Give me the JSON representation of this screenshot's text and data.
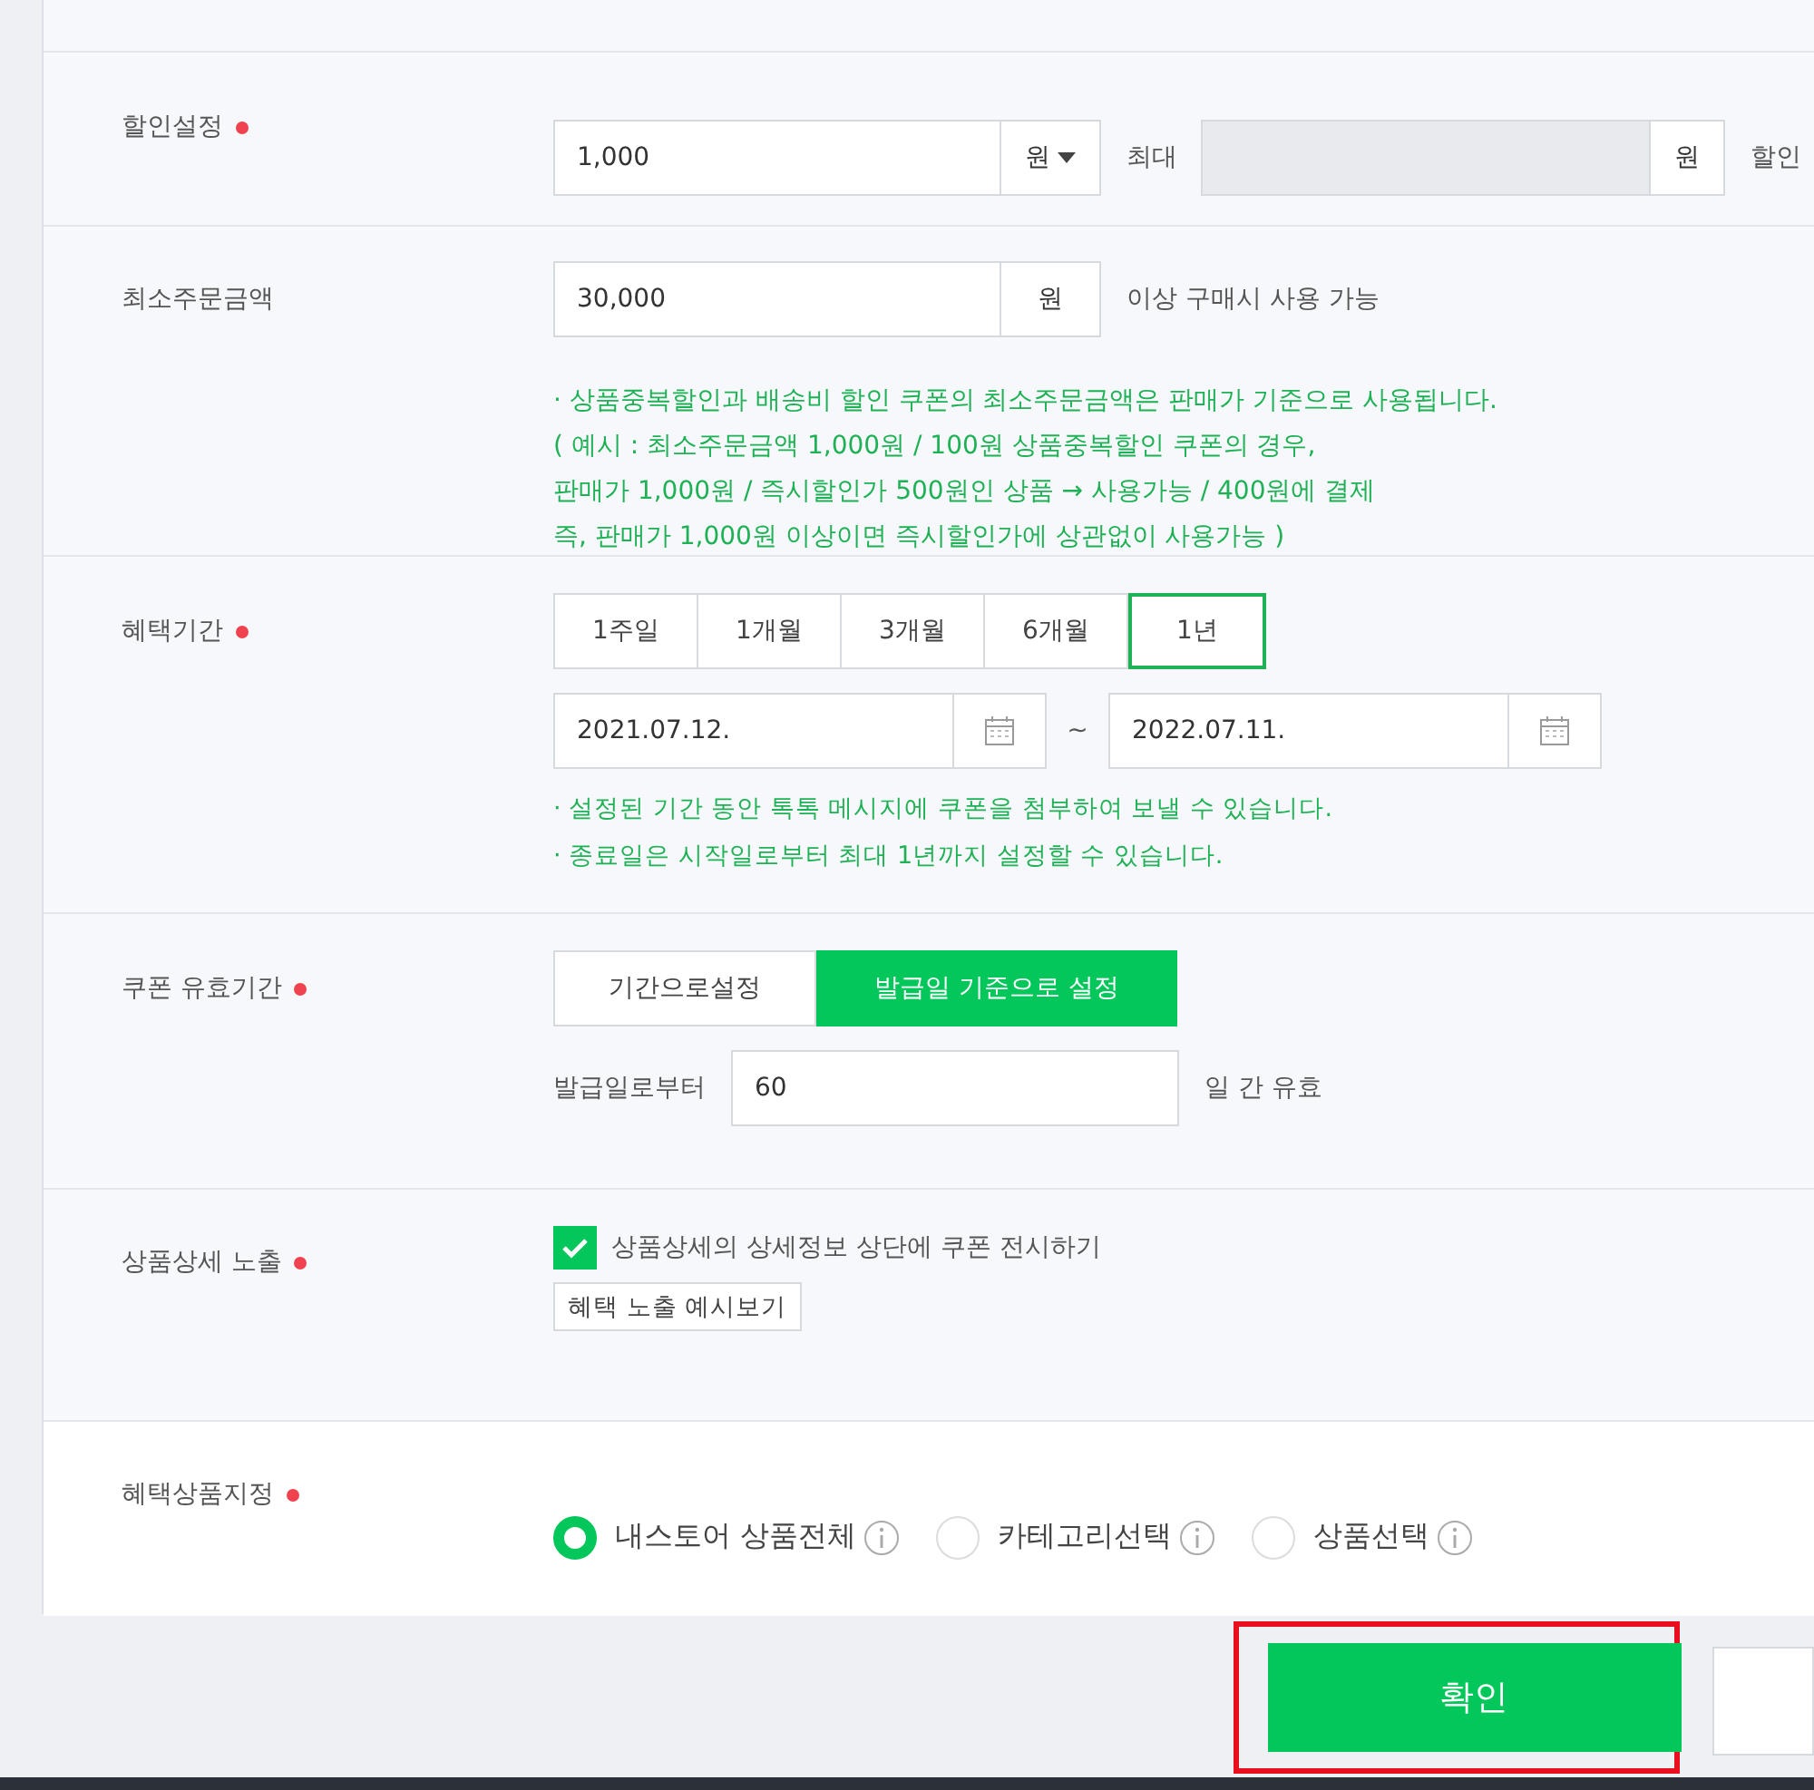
{
  "discount": {
    "label": "할인설정",
    "required": true,
    "amount": "1,000",
    "unit": "원",
    "max_label": "최대",
    "max_unit": "원",
    "suffix": "할인"
  },
  "min_order": {
    "label": "최소주문금액",
    "amount": "30,000",
    "unit": "원",
    "suffix": "이상 구매시 사용 가능",
    "notes": [
      "· 상품중복할인과 배송비 할인 쿠폰의 최소주문금액은 판매가 기준으로 사용됩니다.",
      "( 예시 : 최소주문금액 1,000원 / 100원 상품중복할인 쿠폰의 경우,",
      "판매가 1,000원 / 즉시할인가 500원인 상품 → 사용가능 / 400원에 결제",
      "즉, 판매가 1,000원 이상이면 즉시할인가에 상관없이 사용가능 )"
    ]
  },
  "period": {
    "label": "혜택기간",
    "required": true,
    "presets": [
      {
        "label": "1주일",
        "selected": false
      },
      {
        "label": "1개월",
        "selected": false
      },
      {
        "label": "3개월",
        "selected": false
      },
      {
        "label": "6개월",
        "selected": false
      },
      {
        "label": "1년",
        "selected": true
      }
    ],
    "start": "2021.07.12.",
    "separator": "~",
    "end": "2022.07.11.",
    "notes": [
      "· 설정된 기간 동안 톡톡 메시지에 쿠폰을 첨부하여 보낼 수 있습니다.",
      "· 종료일은 시작일로부터 최대 1년까지 설정할 수 있습니다."
    ]
  },
  "validity": {
    "label": "쿠폰 유효기간",
    "required": true,
    "options": [
      {
        "label": "기간으로설정",
        "selected": false
      },
      {
        "label": "발급일 기준으로 설정",
        "selected": true
      }
    ],
    "from_label": "발급일로부터",
    "days": "60",
    "suffix": "일 간 유효"
  },
  "detail": {
    "label": "상품상세 노출",
    "required": true,
    "checked": true,
    "checkbox_label": "상품상세의 상세정보 상단에 쿠폰 전시하기",
    "preview_button": "혜택 노출 예시보기"
  },
  "target": {
    "label": "혜택상품지정",
    "required": true,
    "options": [
      {
        "label": "내스토어 상품전체",
        "selected": true
      },
      {
        "label": "카테고리선택",
        "selected": false
      },
      {
        "label": "상품선택",
        "selected": false
      }
    ]
  },
  "confirm": {
    "label": "확인",
    "highlighted": true
  }
}
